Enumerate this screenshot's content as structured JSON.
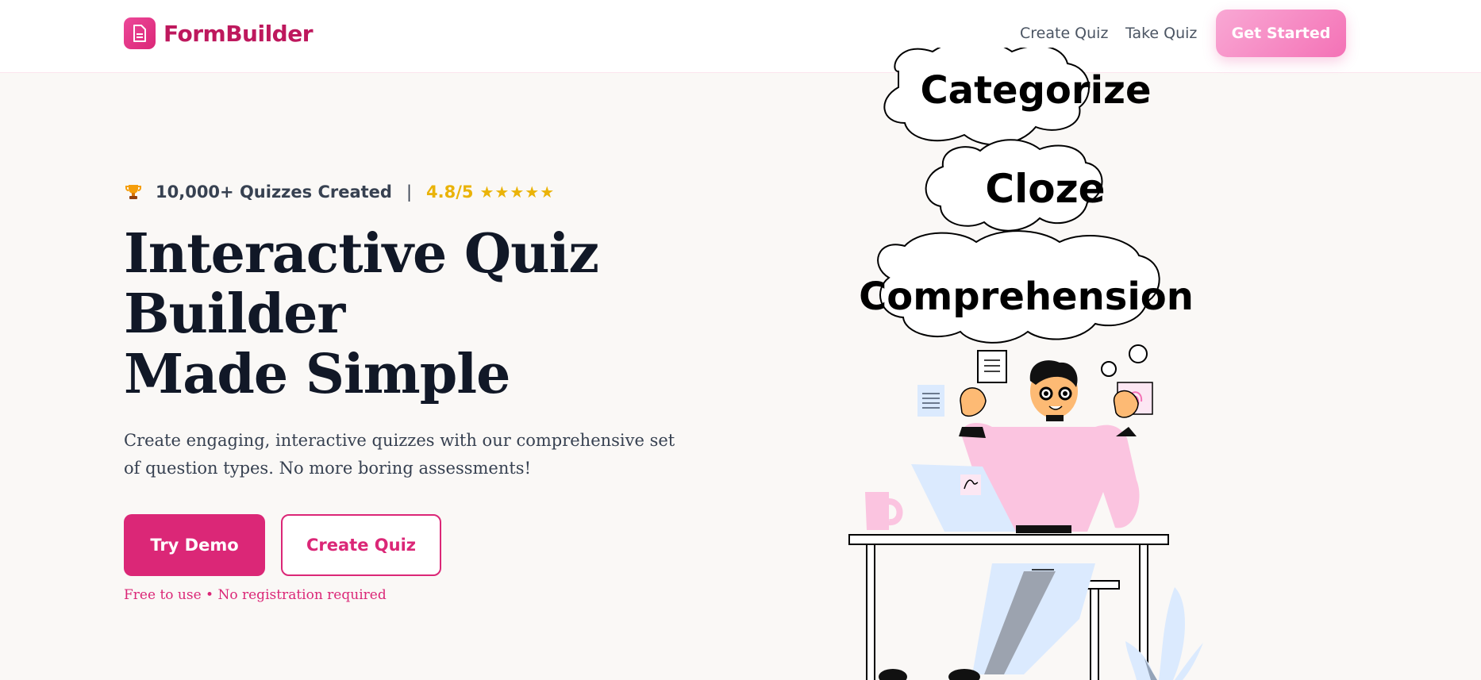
{
  "header": {
    "brand": "FormBuilder",
    "brand_icon": "document-icon",
    "nav": [
      "Create Quiz",
      "Take Quiz"
    ],
    "cta": "Get Started"
  },
  "hero": {
    "stat_icon": "trophy-icon",
    "stat_text": "10,000+ Quizzes Created",
    "separator": "|",
    "rating": "4.8/5",
    "stars": "★★★★★",
    "title_lines": [
      "Interactive Quiz",
      "Builder",
      "Made Simple"
    ],
    "subtitle": "Create engaging, interactive quizzes with our comprehensive set of question types. No more boring assessments!",
    "primary_btn": "Try Demo",
    "secondary_btn": "Create Quiz",
    "note": "Free to use • No registration required"
  },
  "illustration": {
    "bubbles": [
      "Categorize",
      "Cloze",
      "Comprehension"
    ]
  },
  "colors": {
    "brand": "#be185d",
    "primary": "#db2777",
    "accent_light": "#f9a8d4",
    "rating": "#eab308",
    "background": "#faf8f6"
  }
}
